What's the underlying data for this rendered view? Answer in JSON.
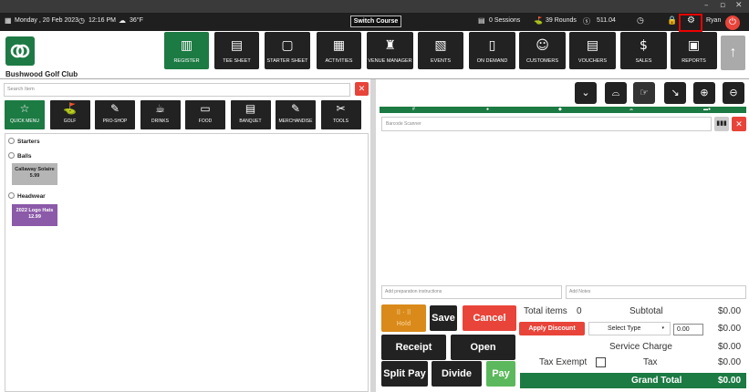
{
  "window": {
    "minimize": "–",
    "restore": "▫",
    "close": "✕"
  },
  "topbar": {
    "date": "Monday , 20 Feb 2023",
    "time": "12:16 PM",
    "weather": "36°F",
    "switch_course": "Switch Course",
    "sessions": "0 Sessions",
    "rounds": "39 Rounds",
    "amount": "511.04",
    "user": "Ryan"
  },
  "club_name": "Bushwood Golf Club",
  "nav": [
    {
      "label": "REGISTER",
      "icon": "register-icon",
      "glyph": "▥"
    },
    {
      "label": "TEE SHEET",
      "icon": "tee-sheet-icon",
      "glyph": "▤"
    },
    {
      "label": "STARTER SHEET",
      "icon": "tablet-icon",
      "glyph": "▢"
    },
    {
      "label": "ACTIVITIES",
      "icon": "calendar-icon",
      "glyph": "▦"
    },
    {
      "label": "VENUE MANAGER",
      "icon": "venue-icon",
      "glyph": "♜"
    },
    {
      "label": "EVENTS",
      "icon": "events-icon",
      "glyph": "▧"
    },
    {
      "label": "ON DEMAND",
      "icon": "on-demand-icon",
      "glyph": "▯"
    },
    {
      "label": "CUSTOMERS",
      "icon": "customers-icon",
      "glyph": "☺"
    },
    {
      "label": "VOUCHERS",
      "icon": "vouchers-icon",
      "glyph": "▤"
    },
    {
      "label": "SALES",
      "icon": "sales-icon",
      "glyph": "$"
    },
    {
      "label": "REPORTS",
      "icon": "reports-icon",
      "glyph": "▣"
    }
  ],
  "search": {
    "placeholder": "Search Item"
  },
  "categories": [
    {
      "label": "QUICK MENU",
      "icon": "star-icon",
      "glyph": "☆"
    },
    {
      "label": "GOLF",
      "icon": "golf-icon",
      "glyph": "⛳"
    },
    {
      "label": "PRO-SHOP",
      "icon": "pro-shop-icon",
      "glyph": "✎"
    },
    {
      "label": "DRINKS",
      "icon": "drinks-icon",
      "glyph": "☕"
    },
    {
      "label": "FOOD",
      "icon": "food-icon",
      "glyph": "▭"
    },
    {
      "label": "BANQUET",
      "icon": "banquet-icon",
      "glyph": "▤"
    },
    {
      "label": "MERCHANDISE",
      "icon": "merchandise-icon",
      "glyph": "✎"
    },
    {
      "label": "TOOLS",
      "icon": "tools-icon",
      "glyph": "✂"
    }
  ],
  "sections": {
    "starters": "Starters",
    "balls": "Balls",
    "headwear": "Headwear"
  },
  "items": [
    {
      "name": "Callaway Solaire",
      "price": "5.99",
      "color": "#b5b5b5"
    },
    {
      "name": "2022 Logo Hats",
      "price": "12.99",
      "color": "#8b5aa8"
    }
  ],
  "cart": {
    "barcode_placeholder": "Barcode Scanner",
    "prep_placeholder": "Add preparation instructions",
    "notes_placeholder": "Add Notes"
  },
  "actions": {
    "hold": "Hold",
    "save": "Save",
    "cancel": "Cancel",
    "receipt": "Receipt",
    "open": "Open",
    "split_pay": "Split Pay",
    "divide_pay": "Divide Pay",
    "pay": "Pay"
  },
  "summary": {
    "total_items_label": "Total items",
    "total_items": "0",
    "subtotal_label": "Subtotal",
    "subtotal": "$0.00",
    "apply_discount": "Apply Discount",
    "select_type": "Select Type",
    "discount_value": "0.00",
    "discount": "$0.00",
    "service_charge_label": "Service Charge",
    "service_charge": "$0.00",
    "tax_exempt_label": "Tax Exempt",
    "tax_label": "Tax",
    "tax": "$0.00",
    "grand_total_label": "Grand Total",
    "grand_total": "$0.00"
  },
  "colors": {
    "brand_green": "#1c7a43",
    "danger_red": "#e8443a",
    "dark": "#222222",
    "hold_orange": "#d98a1a",
    "pay_green": "#5cb85c"
  }
}
